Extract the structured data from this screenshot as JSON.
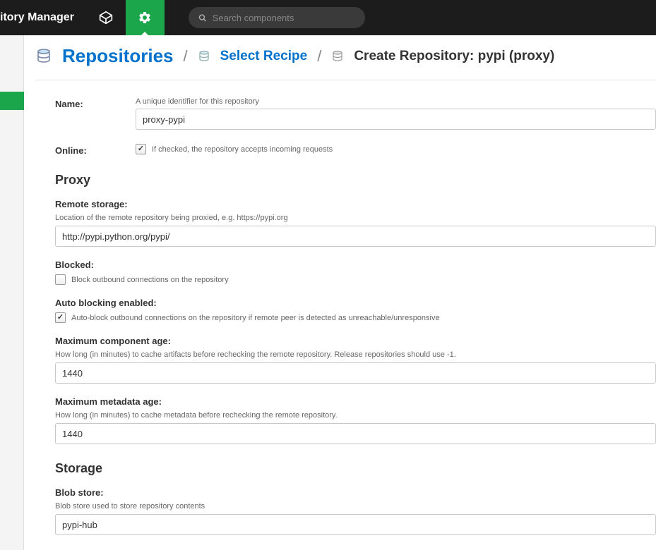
{
  "header": {
    "app_title": "itory Manager",
    "search_placeholder": "Search components"
  },
  "breadcrumb": {
    "root": "Repositories",
    "select_recipe": "Select Recipe",
    "current": "Create Repository: pypi (proxy)"
  },
  "form": {
    "name": {
      "label": "Name:",
      "help": "A unique identifier for this repository",
      "value": "proxy-pypi"
    },
    "online": {
      "label": "Online:",
      "help": "If checked, the repository accepts incoming requests",
      "checked": true
    }
  },
  "proxy": {
    "heading": "Proxy",
    "remote_storage": {
      "label": "Remote storage:",
      "help": "Location of the remote repository being proxied, e.g. https://pypi.org",
      "value": "http://pypi.python.org/pypi/"
    },
    "blocked": {
      "label": "Blocked:",
      "help": "Block outbound connections on the repository",
      "checked": false
    },
    "auto_blocking": {
      "label": "Auto blocking enabled:",
      "help": "Auto-block outbound connections on the repository if remote peer is detected as unreachable/unresponsive",
      "checked": true
    },
    "max_component_age": {
      "label": "Maximum component age:",
      "help": "How long (in minutes) to cache artifacts before rechecking the remote repository. Release repositories should use -1.",
      "value": "1440"
    },
    "max_metadata_age": {
      "label": "Maximum metadata age:",
      "help": "How long (in minutes) to cache metadata before rechecking the remote repository.",
      "value": "1440"
    }
  },
  "storage": {
    "heading": "Storage",
    "blob_store": {
      "label": "Blob store:",
      "help": "Blob store used to store repository contents",
      "value": "pypi-hub"
    }
  }
}
